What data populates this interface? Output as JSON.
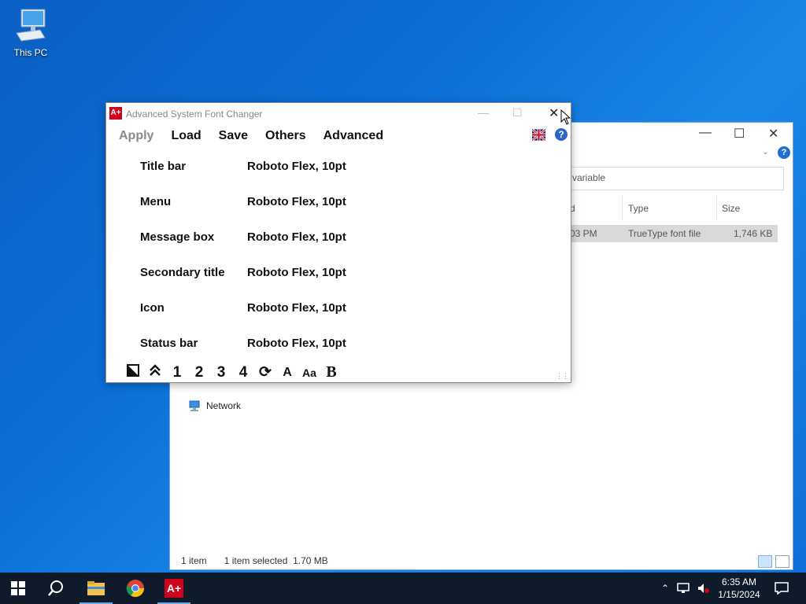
{
  "desktop": {
    "icon_label": "This PC"
  },
  "explorer": {
    "search_text": "n variable",
    "columns": {
      "date": "d",
      "type": "Type",
      "size": "Size"
    },
    "row": {
      "date": "03 PM",
      "type": "TrueType font file",
      "size": "1,746 KB"
    },
    "nav_network": "Network",
    "status_items": "1 item",
    "status_selected": "1 item selected  1.70 MB"
  },
  "app": {
    "title": "Advanced System Font Changer",
    "menu": {
      "apply": "Apply",
      "load": "Load",
      "save": "Save",
      "others": "Others",
      "advanced": "Advanced"
    },
    "help_label": "?",
    "icon_text": "A+",
    "settings": [
      {
        "label": "Title bar",
        "value": "Roboto Flex, 10pt"
      },
      {
        "label": "Menu",
        "value": "Roboto Flex, 10pt"
      },
      {
        "label": "Message box",
        "value": "Roboto Flex, 10pt"
      },
      {
        "label": "Secondary title",
        "value": "Roboto Flex, 10pt"
      },
      {
        "label": "Icon",
        "value": "Roboto Flex, 10pt"
      },
      {
        "label": "Status bar",
        "value": "Roboto Flex, 10pt"
      }
    ],
    "toolbar": {
      "t1": "1",
      "t2": "2",
      "t3": "3",
      "t4": "4",
      "font_a": "A",
      "font_aa": "Aa",
      "bold": "B"
    }
  },
  "taskbar": {
    "time": "6:35 AM",
    "date": "1/15/2024",
    "app_icon_text": "A+"
  },
  "colors": {
    "accent": "#d0021b",
    "desktop": "#0b6fd6",
    "taskbar": "#0f1a2a"
  }
}
